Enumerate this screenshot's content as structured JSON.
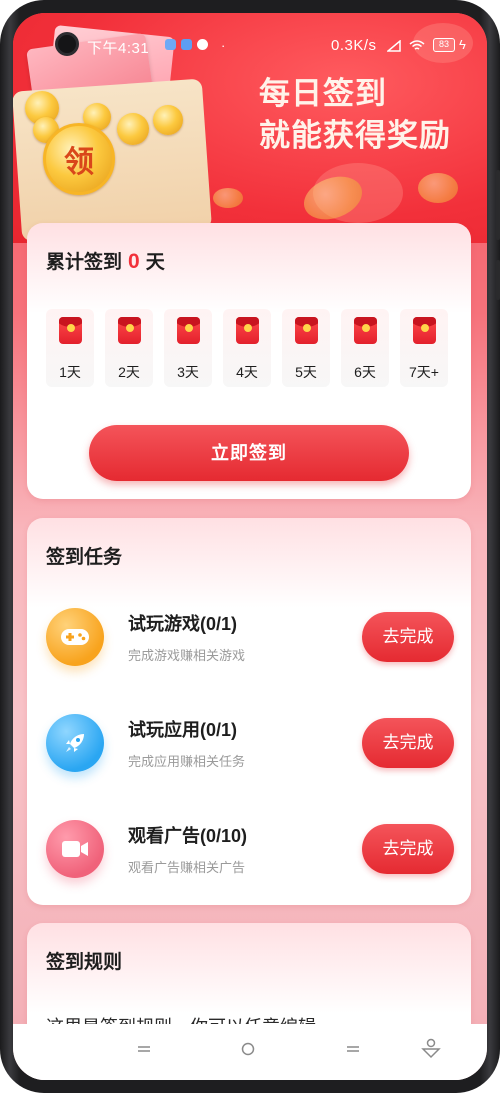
{
  "status_bar": {
    "time": "下午4:31",
    "dot": "·",
    "network_speed": "0.3K/s",
    "battery": "83"
  },
  "banner": {
    "coin_text": "领",
    "title_line1": "每日签到",
    "title_line2": "就能获得奖励"
  },
  "checkin": {
    "title_prefix": "累计签到",
    "count": "0",
    "title_suffix": "天",
    "days": [
      "1天",
      "2天",
      "3天",
      "4天",
      "5天",
      "6天",
      "7天+"
    ],
    "button_label": "立即签到"
  },
  "tasks": {
    "title": "签到任务",
    "items": [
      {
        "name": "试玩游戏(0/1)",
        "desc": "完成游戏赚相关游戏",
        "button": "去完成",
        "icon": "gamepad-icon"
      },
      {
        "name": "试玩应用(0/1)",
        "desc": "完成应用赚相关任务",
        "button": "去完成",
        "icon": "rocket-icon"
      },
      {
        "name": "观看广告(0/10)",
        "desc": "观看广告赚相关广告",
        "button": "去完成",
        "icon": "video-camera-icon"
      }
    ]
  },
  "rules": {
    "title": "签到规则",
    "text": "这里是签到规则，你可以任意编辑"
  },
  "colors": {
    "accent": "#e52a31",
    "banner_red": "#f2303a",
    "text": "#1e1e1e",
    "muted": "#9a9a9a"
  }
}
